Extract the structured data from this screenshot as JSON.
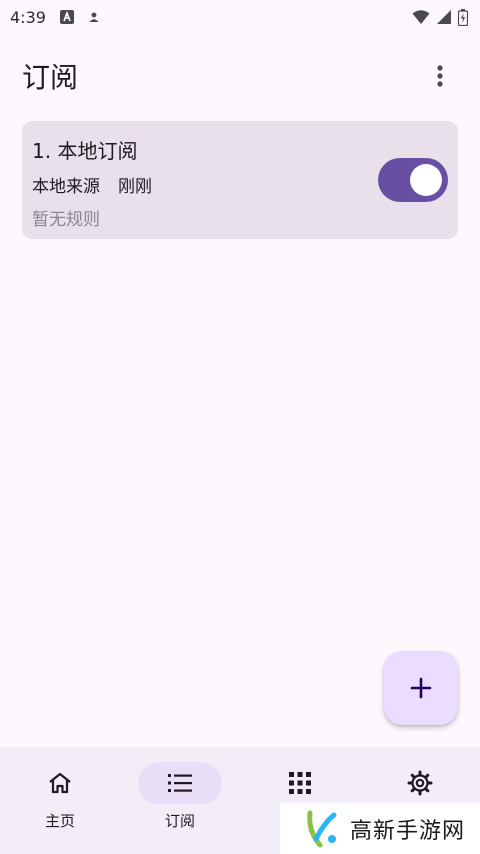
{
  "status_bar": {
    "time": "4:39"
  },
  "app_bar": {
    "title": "订阅"
  },
  "subscription": {
    "title": "1. 本地订阅",
    "source": "本地来源",
    "updated": "刚刚",
    "rules": "暂无规则",
    "enabled": true
  },
  "bottom_nav": {
    "items": [
      {
        "label": "主页",
        "icon": "home-icon"
      },
      {
        "label": "订阅",
        "icon": "list-icon",
        "active": true
      },
      {
        "label": "",
        "icon": "apps-grid-icon"
      },
      {
        "label": "",
        "icon": "gear-icon"
      }
    ]
  },
  "watermark": {
    "text": "高新手游网"
  },
  "colors": {
    "accent": "#6750a4",
    "card": "#e8e0ea",
    "fab": "#eaddff",
    "nav_bg": "#f3edf7",
    "nav_active": "#e8def8"
  }
}
